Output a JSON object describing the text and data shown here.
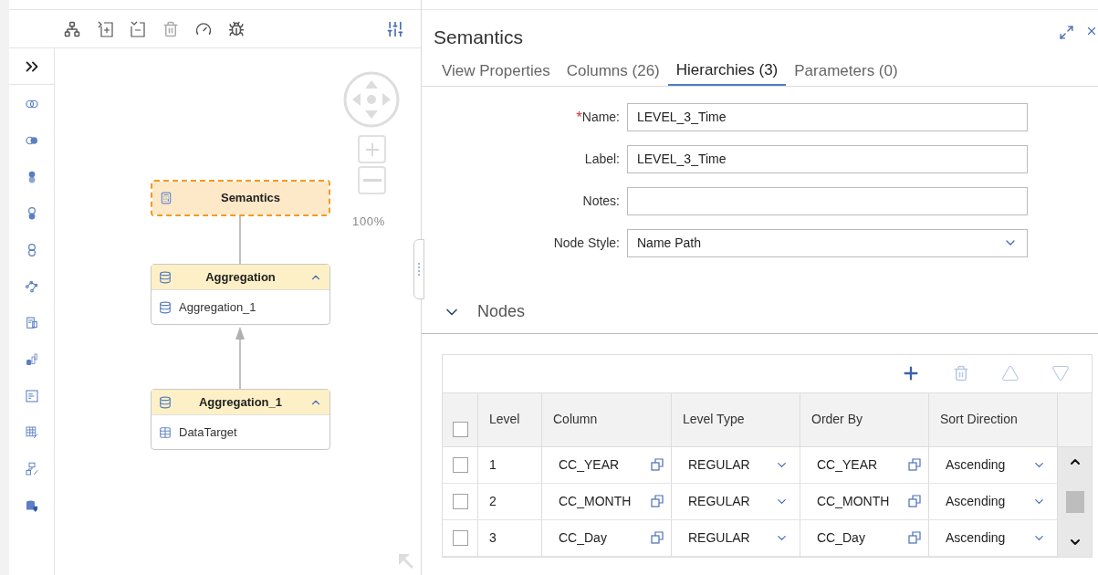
{
  "canvas": {
    "zoom": "100%",
    "nodes": [
      {
        "kind": "semantics",
        "title": "Semantics",
        "selected": true
      },
      {
        "kind": "aggregation",
        "title": "Aggregation",
        "selected": false,
        "expanded": true,
        "items": [
          {
            "kind": "aggregation",
            "label": "Aggregation_1"
          }
        ]
      },
      {
        "kind": "aggregation",
        "title": "Aggregation_1",
        "selected": false,
        "expanded": true,
        "items": [
          {
            "kind": "table",
            "label": "DataTarget"
          }
        ]
      }
    ]
  },
  "panel": {
    "title": "Semantics",
    "required_symbol": "*",
    "tabs": [
      {
        "label": "View Properties",
        "selected": false
      },
      {
        "label": "Columns (26)",
        "selected": false
      },
      {
        "label": "Hierarchies (3)",
        "selected": true
      },
      {
        "label": "Parameters (0)",
        "selected": false
      }
    ],
    "fields": [
      {
        "kind": "input",
        "label": "Name:",
        "required": true,
        "value": "LEVEL_3_Time"
      },
      {
        "kind": "input",
        "label": "Label:",
        "required": false,
        "value": "LEVEL_3_Time"
      },
      {
        "kind": "input",
        "label": "Notes:",
        "required": false
      },
      {
        "kind": "select",
        "label": "Node Style:",
        "required": false,
        "value": "Name Path"
      }
    ],
    "nodes_section": {
      "title": "Nodes",
      "expanded": true,
      "table": {
        "columns": [
          "Level",
          "Column",
          "Level Type",
          "Order By",
          "Sort Direction"
        ],
        "all_checked": false,
        "rows": [
          {
            "checked": false,
            "level": "1",
            "column": "CC_YEAR",
            "level_type": "REGULAR",
            "order_by": "CC_YEAR",
            "sort_direction": "Ascending"
          },
          {
            "checked": false,
            "level": "2",
            "column": "CC_MONTH",
            "level_type": "REGULAR",
            "order_by": "CC_MONTH",
            "sort_direction": "Ascending"
          },
          {
            "checked": false,
            "level": "3",
            "column": "CC_Day",
            "level_type": "REGULAR",
            "order_by": "CC_Day",
            "sort_direction": "Ascending"
          }
        ]
      }
    }
  }
}
